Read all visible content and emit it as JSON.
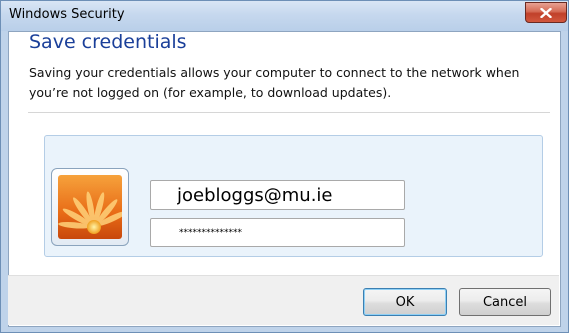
{
  "window": {
    "title": "Windows Security"
  },
  "dialog": {
    "heading": "Save credentials",
    "description": "Saving your credentials allows your computer to connect to the network when you’re not logged on (for example, to download updates)."
  },
  "credential": {
    "username": "joebloggs@mu.ie",
    "password_mask": "**************",
    "avatar_icon": "flower-icon"
  },
  "buttons": {
    "ok_label": "OK",
    "cancel_label": "Cancel"
  },
  "colors": {
    "heading": "#1a3f99",
    "close_button": "#c0402a",
    "tile_background": "#eaf3fb"
  }
}
